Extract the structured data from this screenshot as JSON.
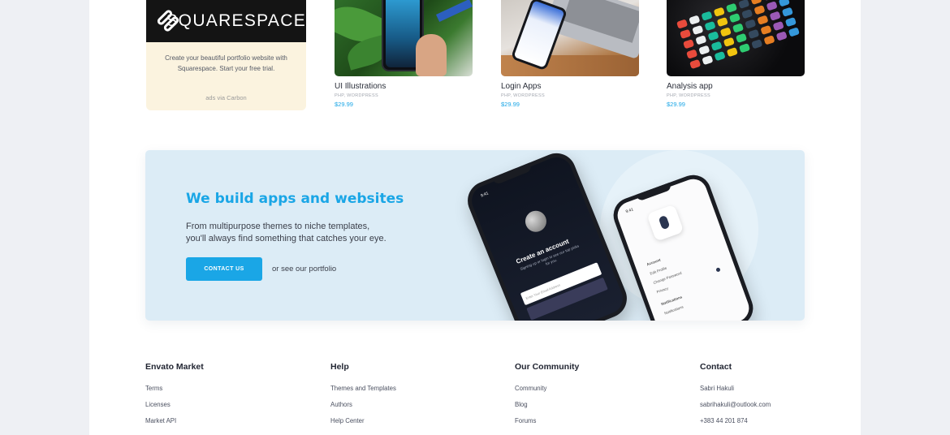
{
  "ad": {
    "brand": "SQUARESPACE",
    "text": "Create your beautiful portfolio website with Squarespace. Start your free trial.",
    "via": "ads via Carbon"
  },
  "products": [
    {
      "name": "UI Illustrations",
      "meta": "PHP, WORDPRESS",
      "price": "$29.99"
    },
    {
      "name": "Login Apps",
      "meta": "PHP, WORDPRESS",
      "price": "$29.99"
    },
    {
      "name": "Analysis app",
      "meta": "PHP, WORDPRESS",
      "price": "$29.99"
    }
  ],
  "banner": {
    "title": "We build apps and websites",
    "lead_line1": "From multipurpose themes to niche templates,",
    "lead_line2": "you'll always find something that catches your eye.",
    "cta_label": "CONTACT US",
    "alt_link": "or see our portfolio",
    "phone1": {
      "time": "9:41",
      "title": "Create an account",
      "subtitle": "Signing up or login to see our top picks for you.",
      "input_placeholder": "Enter Your Email Address"
    },
    "phone2": {
      "time": "9:41",
      "rows": [
        "Account",
        "Edit Profile",
        "Change Password",
        "Privacy",
        "Notifications",
        "Notifications"
      ]
    }
  },
  "footer": {
    "columns": [
      {
        "title": "Envato Market",
        "links": [
          "Terms",
          "Licenses",
          "Market API"
        ]
      },
      {
        "title": "Help",
        "links": [
          "Themes and Templates",
          "Authors",
          "Help Center"
        ]
      },
      {
        "title": "Our Community",
        "links": [
          "Community",
          "Blog",
          "Forums"
        ]
      },
      {
        "title": "Contact",
        "links": [
          "Sabri Hakuli",
          "sabrihakuli@outlook.com",
          "+383 44 201 874"
        ]
      }
    ]
  },
  "colors": {
    "accent": "#1aa6e6",
    "banner_bg": "#dcecf6",
    "page_bg": "#eef0f4"
  }
}
